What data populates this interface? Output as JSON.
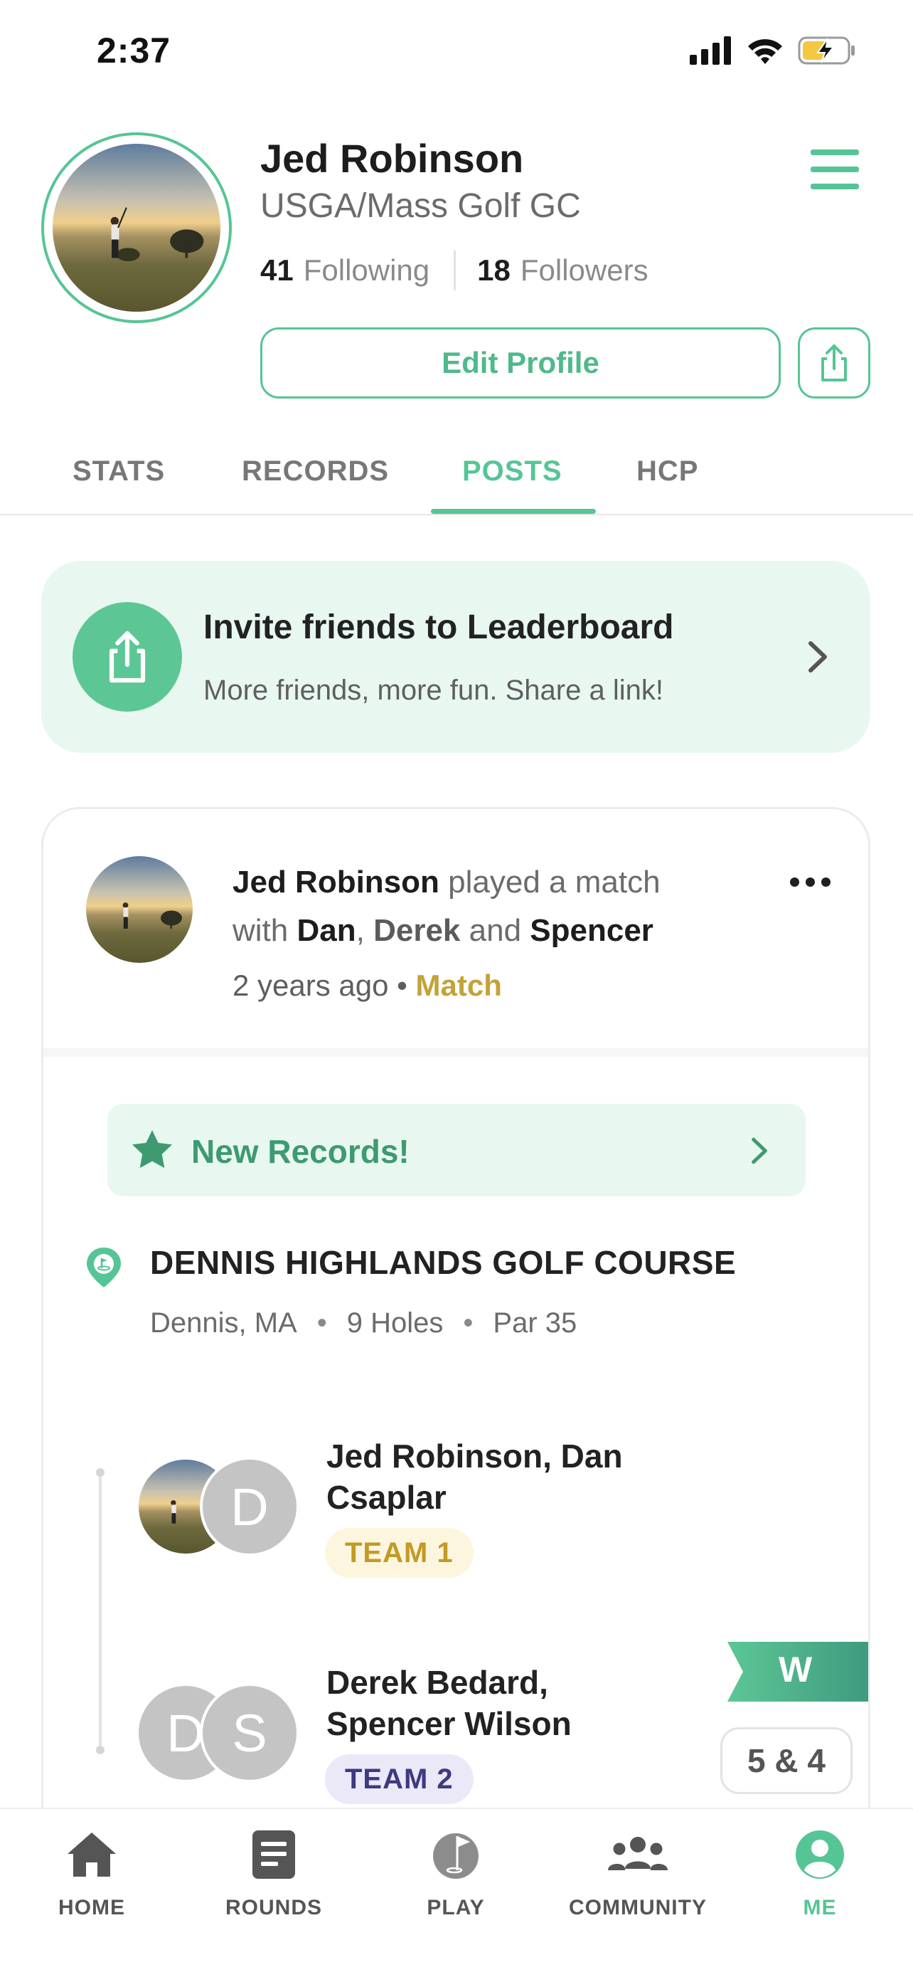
{
  "status_bar": {
    "time": "2:37"
  },
  "profile": {
    "name": "Jed Robinson",
    "club": "USGA/Mass Golf GC",
    "following_count": "41",
    "following_label": "Following",
    "followers_count": "18",
    "followers_label": "Followers",
    "edit_profile_label": "Edit Profile"
  },
  "tabs": [
    {
      "label": "STATS",
      "active": false
    },
    {
      "label": "RECORDS",
      "active": false
    },
    {
      "label": "POSTS",
      "active": true
    },
    {
      "label": "HCP",
      "active": false
    }
  ],
  "invite": {
    "title": "Invite friends to Leaderboard",
    "subtitle": "More friends, more fun. Share a link!"
  },
  "post": {
    "author": "Jed Robinson",
    "action": "played a match",
    "with_prefix": "with",
    "player1": "Dan",
    "player2": "Derek",
    "and_word": "and",
    "player3": "Spencer",
    "time_ago": "2 years ago",
    "separator": "•",
    "type": "Match",
    "records_banner": "New Records!",
    "course": {
      "name": "DENNIS HIGHLANDS GOLF COURSE",
      "location": "Dennis, MA",
      "holes": "9 Holes",
      "par": "Par 35"
    },
    "teams": [
      {
        "names": "Jed Robinson, Dan Csaplar",
        "badge": "TEAM 1",
        "avatar_letters": [
          "D"
        ]
      },
      {
        "names": "Derek Bedard, Spencer Wilson",
        "badge": "TEAM 2",
        "avatar_letters": [
          "D",
          "S"
        ]
      }
    ],
    "result": {
      "flag": "W",
      "score": "5 & 4"
    }
  },
  "bottom_nav": [
    {
      "label": "HOME",
      "icon": "home-icon",
      "active": false
    },
    {
      "label": "ROUNDS",
      "icon": "scorecard-icon",
      "active": false
    },
    {
      "label": "PLAY",
      "icon": "golf-ball-flag-icon",
      "active": false
    },
    {
      "label": "COMMUNITY",
      "icon": "community-icon",
      "active": false
    },
    {
      "label": "ME",
      "icon": "profile-icon",
      "active": true
    }
  ],
  "colors": {
    "accent": "#56c595",
    "accent_light": "#e8f8f1",
    "match_gold": "#c3a238",
    "team1_bg": "#fdf6df",
    "team2_bg": "#ebe9f8",
    "team2_text": "#3e3a80"
  }
}
